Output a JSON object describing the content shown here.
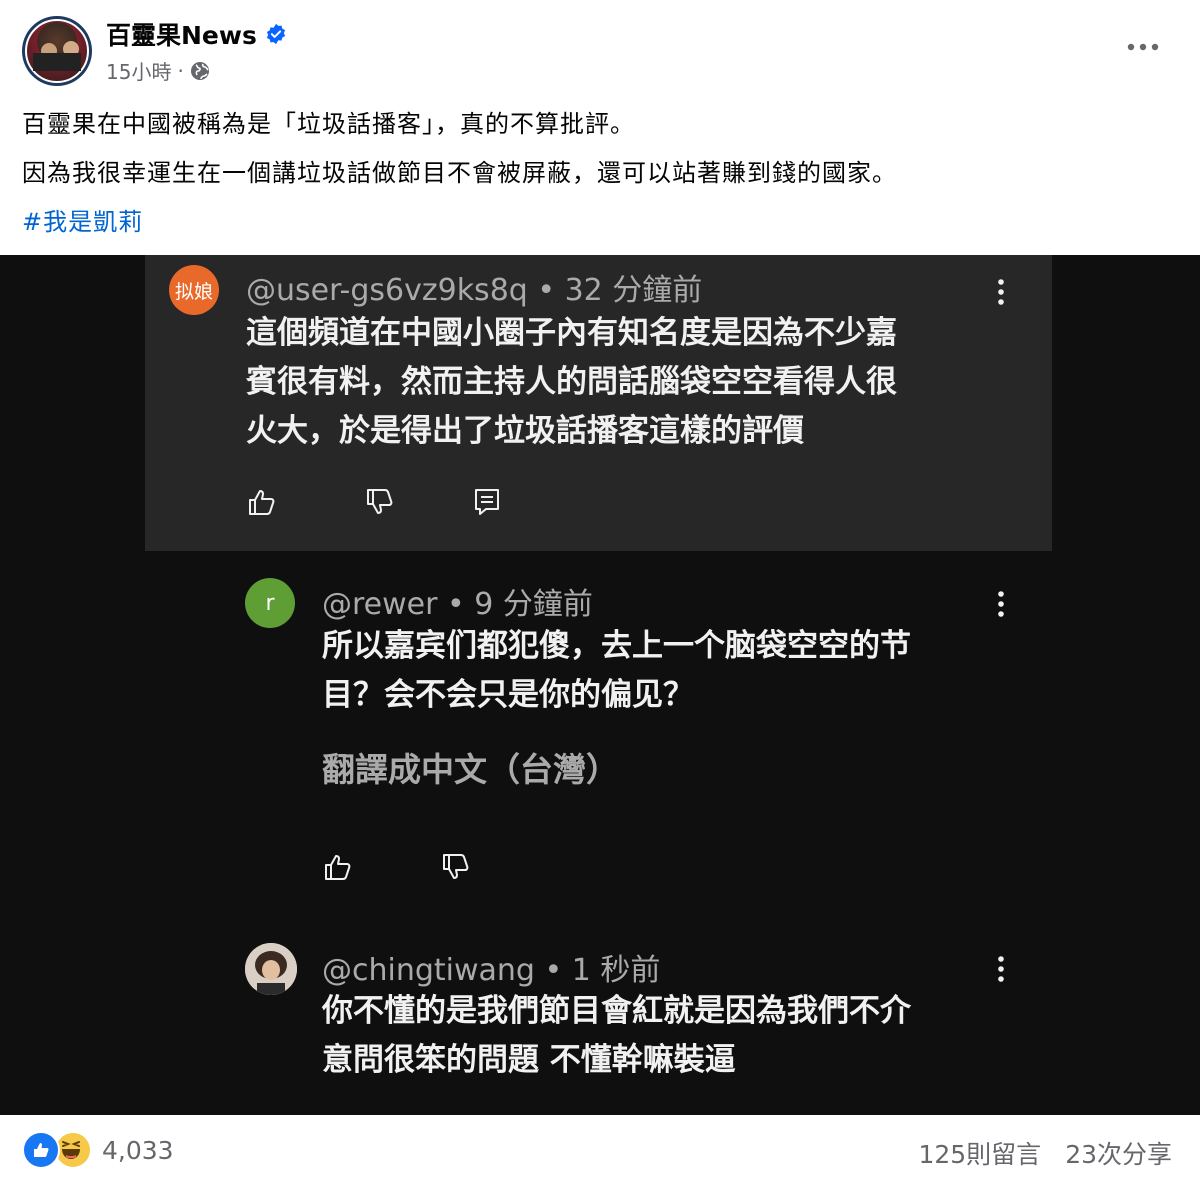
{
  "post": {
    "page_name": "百靈果News",
    "time": "15小時",
    "dot": "·",
    "line1": "百靈果在中國被稱為是「垃圾話播客」，真的不算批評。",
    "line2": "因為我很幸運生在一個講垃圾話做節目不會被屏蔽，還可以站著賺到錢的國家。",
    "hashtag": "#我是凱莉"
  },
  "comments": [
    {
      "avatar_text": "拟娘",
      "avatar_color": "#e8692a",
      "handle": "@user-gs6vz9ks8q • 32 分鐘前",
      "lines": [
        "這個頻道在中國小圈子內有知名度是因為不少嘉",
        "賓很有料，然而主持人的問話腦袋空空看得人很",
        "火大，於是得出了垃圾話播客這樣的評價"
      ]
    },
    {
      "avatar_text": "r",
      "avatar_color": "#5e9e35",
      "handle": "@rewer • 9 分鐘前",
      "lines": [
        "所以嘉宾们都犯傻，去上一个脑袋空空的节",
        "目？会不会只是你的偏见？"
      ],
      "translate": "翻譯成中文（台灣）"
    },
    {
      "avatar_text": "",
      "handle": "@chingtiwang • 1 秒前",
      "lines": [
        "你不懂的是我們節目會紅就是因為我們不介",
        "意問很笨的問題  不懂幹嘛裝逼"
      ]
    }
  ],
  "footer": {
    "reaction_count": "4,033",
    "comments": "125則留言",
    "shares": "23次分享"
  }
}
